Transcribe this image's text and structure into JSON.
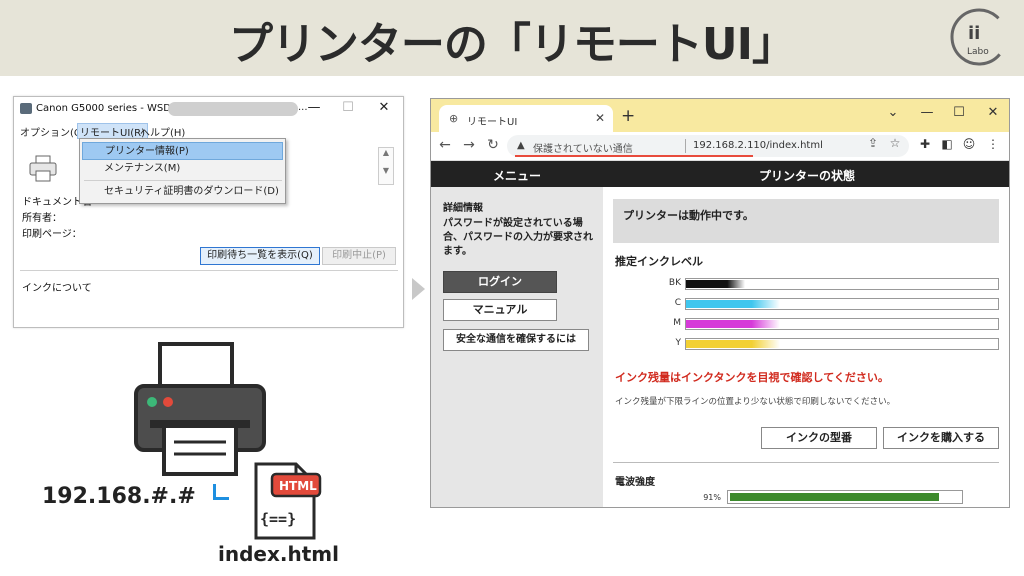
{
  "slide_title": "プリンターの「リモートUI」",
  "logo": {
    "text": "ii",
    "sub": "Labo"
  },
  "win_dialog": {
    "title": "Canon G5000 series - WSD-",
    "title_suffix": "...",
    "menu": [
      "オプション(O)",
      "リモートUI(R)",
      "ヘルプ(H)"
    ],
    "dropdown": [
      "プリンター情報(P)",
      "メンテナンス(M)",
      "セキュリティ証明書のダウンロード(D)"
    ],
    "labels": [
      "ドキュメント名",
      "所有者：",
      "印刷ページ："
    ],
    "btn_queue": "印刷待ち一覧を表示(Q)",
    "btn_stop": "印刷中止(P)",
    "ink_about": "インクについて"
  },
  "illustration": {
    "ip": "192.168.#.#",
    "file_badge": "HTML",
    "file_code": "{==}",
    "filename": "index.html"
  },
  "browser": {
    "tab_title": "リモートUI",
    "new_tab": "+",
    "omnibox": {
      "security": "保護されていない通信",
      "url": "192.168.2.110/index.html"
    },
    "nav_left": "メニュー",
    "nav_right": "プリンターの状態",
    "sidebar": {
      "heading": "詳細情報",
      "password_note": "パスワードが設定されている場合、パスワードの入力が要求されます。",
      "login": "ログイン",
      "manual": "マニュアル",
      "secure": "安全な通信を確保するには"
    },
    "main": {
      "status": "プリンターは動作中です。",
      "ink_title": "推定インクレベル",
      "inks": [
        {
          "label": "BK",
          "color": "#111111",
          "level": 0.19
        },
        {
          "label": "C",
          "color": "#3fc6ee",
          "level": 0.3
        },
        {
          "label": "M",
          "color": "#d63ad9",
          "level": 0.3
        },
        {
          "label": "Y",
          "color": "#f2d033",
          "level": 0.3
        }
      ],
      "ink_warning": "インク残量はインクタンクを目視で確認してください。",
      "ink_note": "インク残量が下限ラインの位置より少ない状態で印刷しないでください。",
      "btn_model": "インクの型番",
      "btn_buy": "インクを購入する",
      "signal_title": "電波強度",
      "signal_percent": "91%",
      "signal_level": 0.91
    }
  }
}
